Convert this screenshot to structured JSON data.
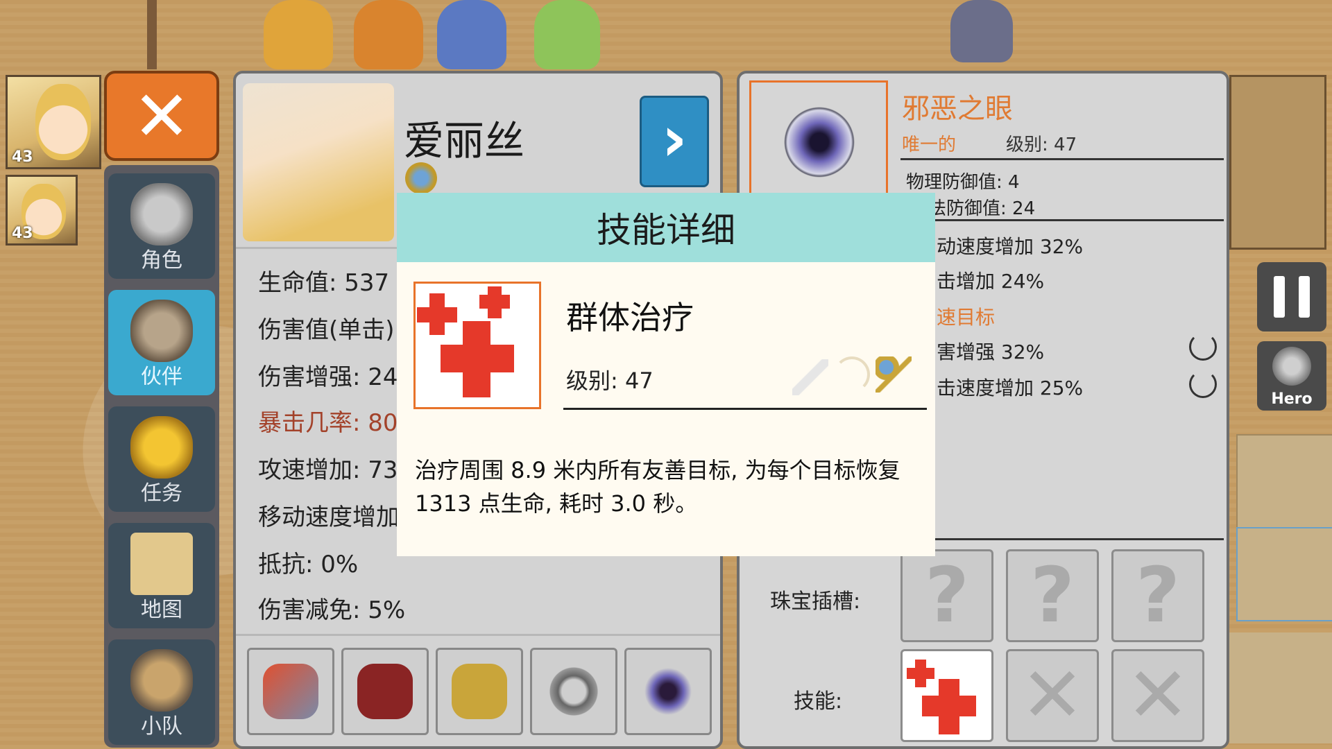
{
  "party": [
    {
      "level": "43"
    },
    {
      "level": "43"
    }
  ],
  "menu": {
    "close_label": "✕",
    "items": [
      {
        "label": "角色",
        "icon": "helmet-icon"
      },
      {
        "label": "伙伴",
        "icon": "horned-helmet-icon"
      },
      {
        "label": "任务",
        "icon": "trophy-icon"
      },
      {
        "label": "地图",
        "icon": "map-scroll-icon"
      },
      {
        "label": "小队",
        "icon": "party-icon"
      }
    ]
  },
  "character": {
    "name": "爱丽丝",
    "next_label": "›",
    "stats": {
      "hp": "生命值: 537 /",
      "damage": "伤害值(单击)",
      "damage_boost": "伤害增强: 24",
      "crit": "暴击几率: 80",
      "attack_speed": "攻速增加: 73",
      "move_speed": "移动速度增加",
      "resist": "抵抗: 0%",
      "damage_reduction": "伤害减免: 5%"
    }
  },
  "item": {
    "name": "邪恶之眼",
    "rarity": "唯一的",
    "level": "级别: 47",
    "phys_def": "物理防御值: 4",
    "magic_def": "法防御值: 24",
    "bonus1": "动速度增加 32%",
    "bonus2": "击增加 24%",
    "bonus3": "速目标",
    "bonus4": "害增强 32%",
    "bonus5": "击速度增加 25%",
    "gem_label": "珠宝插槽:",
    "skill_label": "技能:",
    "gem_slots": [
      "?",
      "?",
      "?"
    ]
  },
  "dialog": {
    "title": "技能详细",
    "skill_name": "群体治疗",
    "skill_level": "级别: 47",
    "description": "治疗周围 8.9 米内所有友善目标, 为每个目标恢复 1313 点生命, 耗时 3.0 秒。"
  },
  "hud": {
    "hero_label": "Hero"
  },
  "colors": {
    "accent_orange": "#e8782a",
    "menu_active": "#3aa9cf",
    "dialog_header": "#9fdfdb",
    "item_name": "#e07a32"
  }
}
